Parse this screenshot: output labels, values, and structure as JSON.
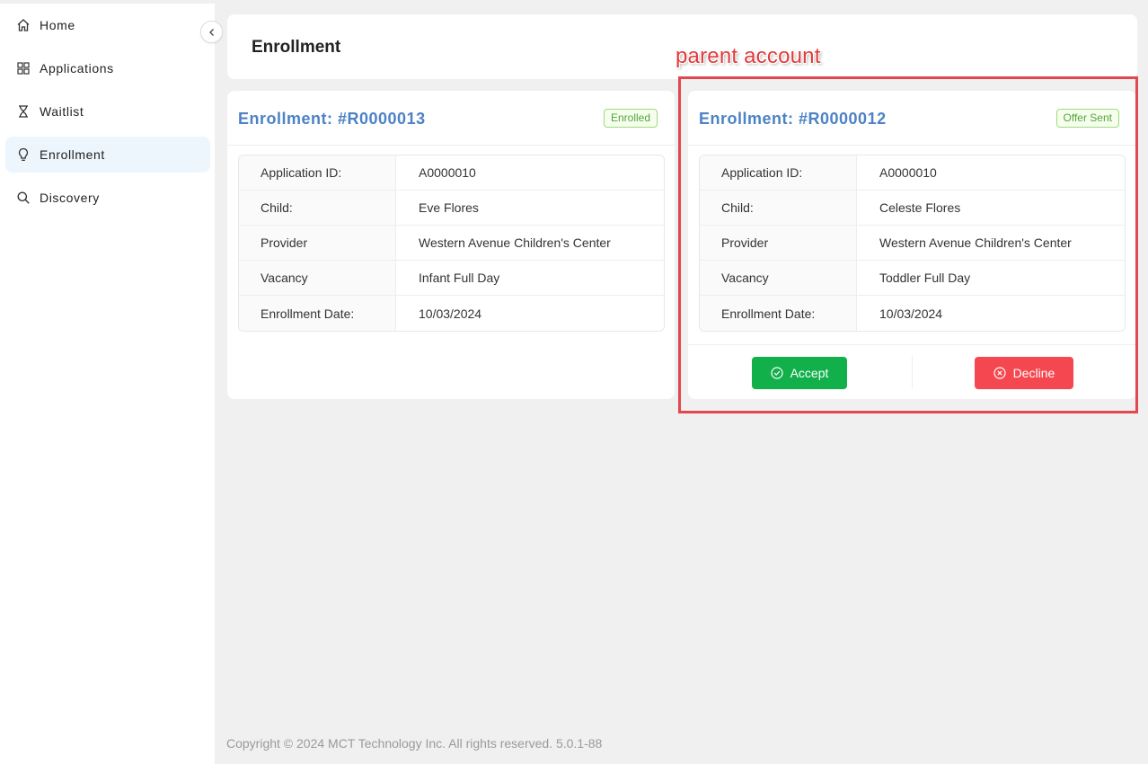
{
  "sidebar": {
    "items": [
      {
        "label": "Home",
        "icon": "home-icon"
      },
      {
        "label": "Applications",
        "icon": "grid-icon"
      },
      {
        "label": "Waitlist",
        "icon": "hourglass-icon"
      },
      {
        "label": "Enrollment",
        "icon": "lightbulb-icon",
        "active": true
      },
      {
        "label": "Discovery",
        "icon": "search-icon"
      }
    ]
  },
  "header": {
    "title": "Enrollment",
    "annotation": "parent account"
  },
  "cards": [
    {
      "title": "Enrollment: #R0000013",
      "status": "Enrolled",
      "rows": [
        {
          "key": "Application ID:",
          "value": "A0000010"
        },
        {
          "key": "Child:",
          "value": "Eve Flores"
        },
        {
          "key": "Provider",
          "value": "Western Avenue Children's Center"
        },
        {
          "key": "Vacancy",
          "value": "Infant Full Day"
        },
        {
          "key": "Enrollment Date:",
          "value": "10/03/2024"
        }
      ]
    },
    {
      "title": "Enrollment: #R0000012",
      "status": "Offer Sent",
      "rows": [
        {
          "key": "Application ID:",
          "value": "A0000010"
        },
        {
          "key": "Child:",
          "value": "Celeste Flores"
        },
        {
          "key": "Provider",
          "value": "Western Avenue Children's Center"
        },
        {
          "key": "Vacancy",
          "value": "Toddler Full Day"
        },
        {
          "key": "Enrollment Date:",
          "value": "10/03/2024"
        }
      ],
      "actions": {
        "accept_label": "Accept",
        "decline_label": "Decline"
      }
    }
  ],
  "footer": {
    "copyright": "Copyright © 2024 MCT Technology Inc. All rights reserved. 5.0.1-88"
  },
  "colors": {
    "accent": "#4d82c5",
    "accept": "#12b04a",
    "decline": "#f5474f",
    "highlight": "#e2484d"
  }
}
